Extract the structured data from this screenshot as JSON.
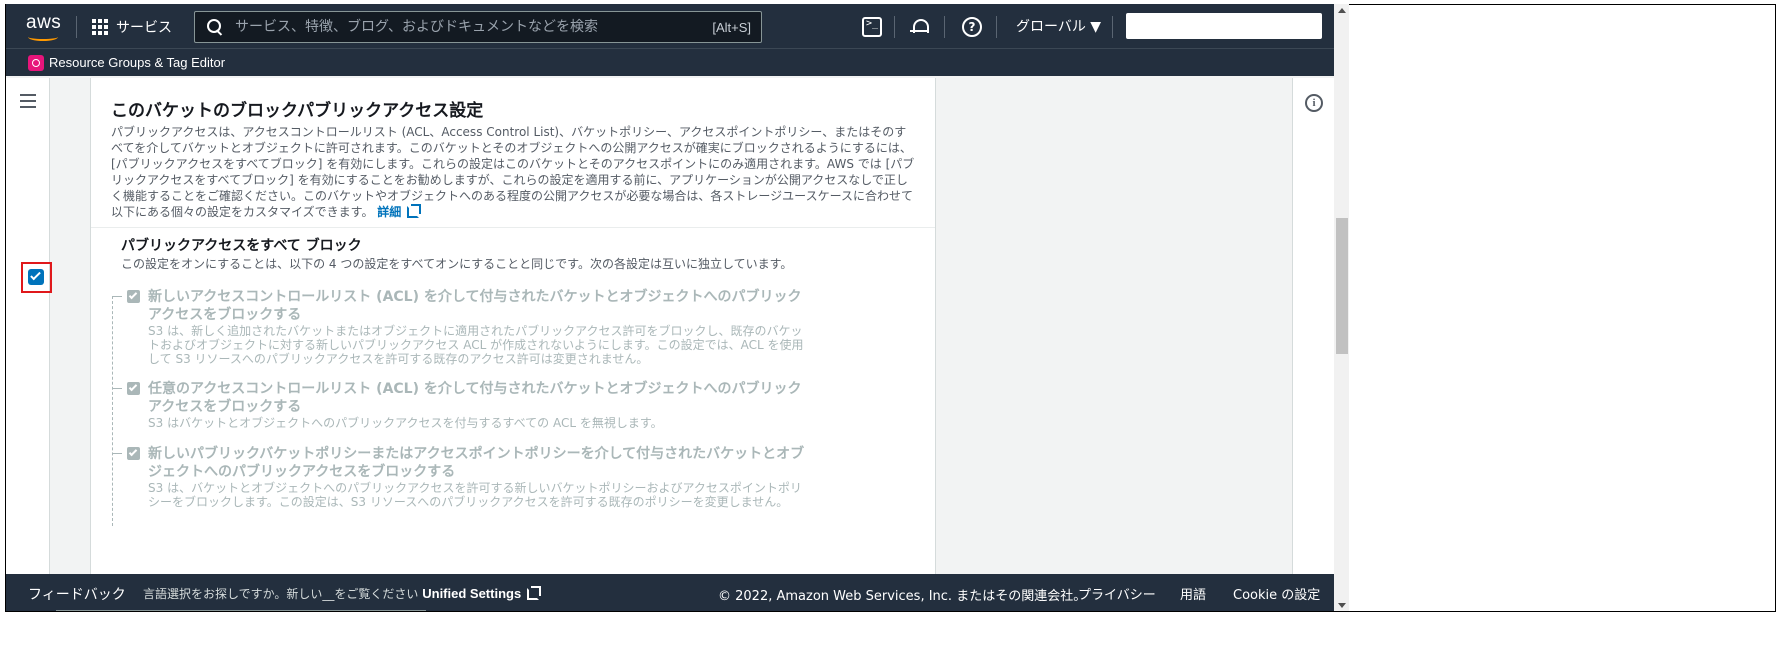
{
  "topnav": {
    "logo_text": "aws",
    "services_label": "サービス",
    "search_placeholder": "サービス、特徴、ブログ、およびドキュメントなどを検索",
    "search_shortcut": "[Alt+S]",
    "help_glyph": "?",
    "region_label": "グローバル ▼"
  },
  "subnav": {
    "service_label": "Resource Groups & Tag Editor"
  },
  "right_rail": {
    "info_glyph": "i"
  },
  "main": {
    "title": "このバケットのブロックパブリックアクセス設定",
    "description": "パブリックアクセスは、アクセスコントロールリスト (ACL、Access Control List)、バケットポリシー、アクセスポイントポリシー、またはそのすべてを介してバケットとオブジェクトに許可されます。このバケットとそのオブジェクトへの公開アクセスが確実にブロックされるようにするには、[パブリックアクセスをすべてブロック] を有効にします。これらの設定はこのバケットとそのアクセスポイントにのみ適用されます。AWS では [パブリックアクセスをすべてブロック] を有効にすることをお勧めしますが、これらの設定を適用する前に、アプリケーションが公開アクセスなしで正しく機能することをご確認ください。このバケットやオブジェクトへのある程度の公開アクセスが必要な場合は、各ストレージユースケースに合わせて以下にある個々の設定をカスタマイズできます。",
    "learn_more": "詳細",
    "block_all": {
      "label": "パブリックアクセスをすべて ブロック",
      "description": "この設定をオンにすることは、以下の 4 つの設定をすべてオンにすることと同じです。次の各設定は互いに独立しています。",
      "checked": true
    },
    "options": [
      {
        "title": "新しいアクセスコントロールリスト (ACL) を介して付与されたバケットとオブジェクトへのパブリックアクセスをブロックする",
        "description": "S3 は、新しく追加されたバケットまたはオブジェクトに適用されたパブリックアクセス許可をブロックし、既存のバケットおよびオブジェクトに対する新しいパブリックアクセス ACL が作成されないようにします。この設定では、ACL を使用して S3 リソースへのパブリックアクセスを許可する既存のアクセス許可は変更されません。"
      },
      {
        "title": "任意のアクセスコントロールリスト (ACL) を介して付与されたバケットとオブジェクトへのパブリックアクセスをブロックする",
        "description": "S3 はバケットとオブジェクトへのパブリックアクセスを付与するすべての ACL を無視します。"
      },
      {
        "title": "新しいパブリックバケットポリシーまたはアクセスポイントポリシーを介して付与されたバケットとオブジェクトへのパブリックアクセスをブロックする",
        "description": "S3 は、バケットとオブジェクトへのパブリックアクセスを許可する新しいバケットポリシーおよびアクセスポイントポリシーをブロックします。この設定は、S3 リソースへのパブリックアクセスを許可する既存のポリシーを変更しません。"
      }
    ]
  },
  "footer": {
    "feedback": "フィードバック",
    "lang_prompt": "言語選択をお探しですか。新しい__をご覧ください",
    "unified_settings": "Unified Settings",
    "copyright": "© 2022, Amazon Web Services, Inc. またはその関連会社。",
    "privacy": "プライバシー",
    "terms": "用語",
    "cookie": "Cookie の設定"
  },
  "colors": {
    "nav_bg": "#232f3e",
    "link_blue": "#0073bb",
    "highlight_red": "#e0181b",
    "aws_orange": "#ff9900"
  }
}
